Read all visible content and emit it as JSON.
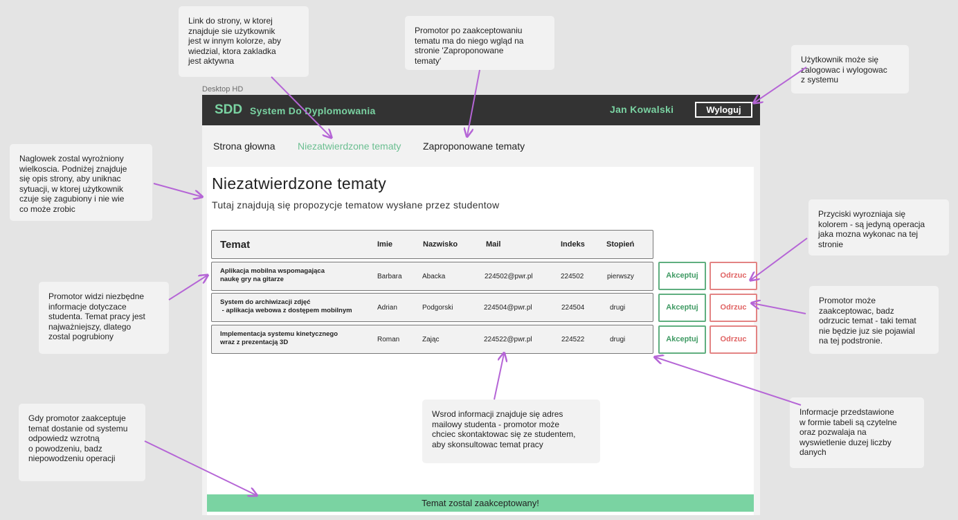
{
  "frame_label": "Desktop HD",
  "app": {
    "brand_short": "SDD",
    "brand_name": "System Do Dyplomowania",
    "user_name": "Jan Kowalski",
    "logout_label": "Wyloguj"
  },
  "nav": [
    {
      "label": "Strona głowna",
      "active": false
    },
    {
      "label": "Niezatwierdzone tematy",
      "active": true
    },
    {
      "label": "Zaproponowane tematy",
      "active": false
    }
  ],
  "page": {
    "title": "Niezatwierdzone tematy",
    "description": "Tutaj znajdują się propozycje tematow wysłane przez studentow"
  },
  "table": {
    "headers": [
      "Temat",
      "Imie",
      "Nazwisko",
      "Mail",
      "Indeks",
      "Stopień"
    ],
    "rows": [
      {
        "topic": "Aplikacja mobilna wspomagająca\nnaukę gry na gitarze",
        "first_name": "Barbara",
        "last_name": "Abacka",
        "mail": "224502@pwr.pl",
        "index": "224502",
        "degree": "pierwszy"
      },
      {
        "topic": "System do archiwizacji zdjęć\n - aplikacja webowa z dostępem mobilnym",
        "first_name": "Adrian",
        "last_name": "Podgorski",
        "mail": "224504@pwr.pl",
        "index": "224504",
        "degree": "drugi"
      },
      {
        "topic": "Implementacja systemu kinetycznego\nwraz z prezentacją 3D",
        "first_name": "Roman",
        "last_name": "Zając",
        "mail": "224522@pwr.pl",
        "index": "224522",
        "degree": "drugi"
      }
    ],
    "accept_label": "Akceptuj",
    "reject_label": "Odrzuc"
  },
  "toast": "Temat zostal zaakceptowany!",
  "annotations": [
    "Link do strony, w ktorej\nznajduje sie użytkownik\njest w innym kolorze, aby\nwiedzial, ktora zakladka\njest aktywna",
    "Promotor po zaakceptowaniu\ntematu ma do niego wgląd na\nstronie 'Zaproponowane\ntematy'",
    "Użytkownik może się\nzalogowac i wylogowac\nz systemu",
    "Naglowek zostal wyrożniony\nwielkoscia. Podniżej znajduje\nsię opis strony, aby uniknac\nsytuacji, w ktorej użytkownik\nczuje się zagubiony i nie wie\nco może zrobic",
    "Przyciski wyrozniaja się\nkolorem - są jedyną operacja\njaka mozna wykonac na tej\nstronie",
    "Promotor widzi niezbędne\ninformacje dotyczace\nstudenta. Temat pracy jest\nnajważniejszy, dlatego\nzostal pogrubiony",
    "Promotor może\nzaakceptowac, badz\nodrzucic temat - taki temat\nnie będzie juz sie pojawial\nna tej podstronie.",
    "Wsrod informacji znajduje się adres\nmailowy studenta -  promotor może\nchciec skontaktowac się ze studentem,\naby skonsultowac temat pracy",
    "Informacje przedstawione\nw formie tabeli są czytelne\noraz pozwalaja na\nwyswietlenie duzej liczby\ndanych",
    "Gdy promotor zaakceptuje\ntemat dostanie od systemu\nodpowiedz wzrotną\no powodzeniu, badz\nniepowodzeniu operacji"
  ],
  "colors": {
    "accent_green": "#7ad3a2",
    "header_dark": "#333333",
    "accept": "#3f9a63",
    "reject": "#e06464",
    "arrow": "#b565d6"
  }
}
